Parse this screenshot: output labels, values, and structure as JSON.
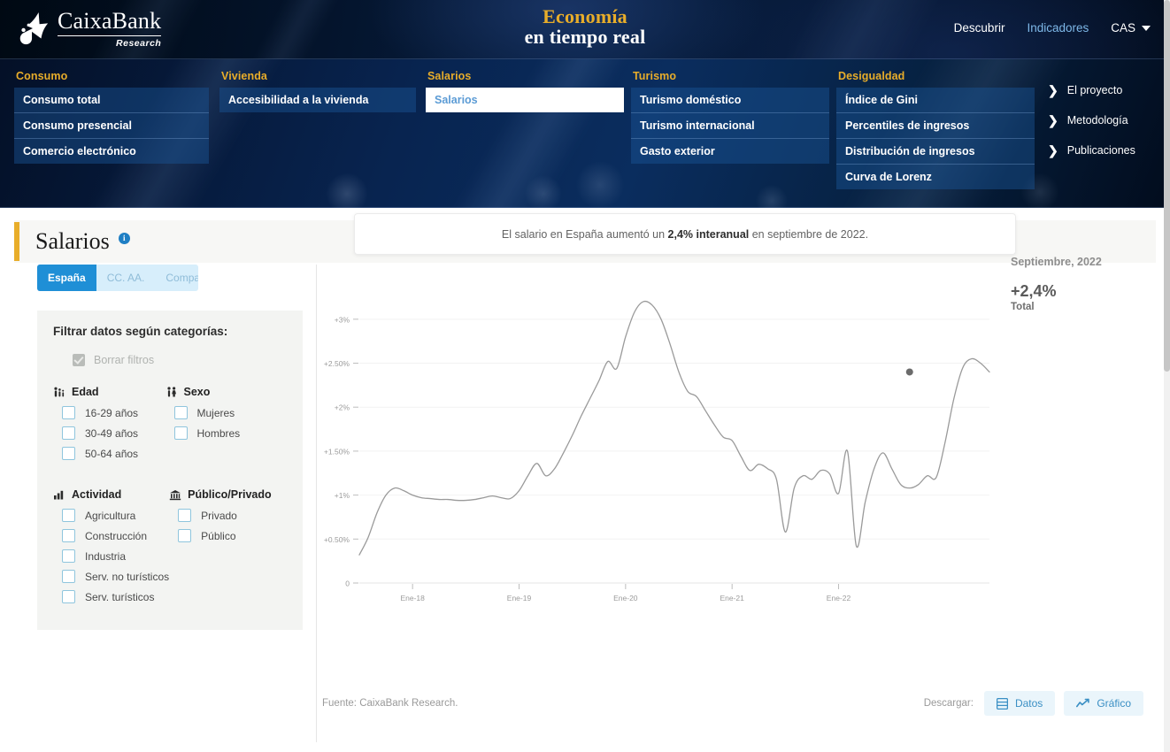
{
  "topbar": {
    "logo_name": "CaixaBank",
    "logo_sub": "Research",
    "brand_line1": "Economía",
    "brand_line2": "en tiempo real",
    "nav": [
      {
        "label": "Descubrir",
        "active": false
      },
      {
        "label": "Indicadores",
        "active": true
      }
    ],
    "lang": "CAS",
    "lang_icon": "chevron-down-icon"
  },
  "mega_menu": {
    "columns": [
      {
        "heading": "Consumo",
        "items": [
          {
            "label": "Consumo total",
            "active": false
          },
          {
            "label": "Consumo presencial",
            "active": false
          },
          {
            "label": "Comercio electrónico",
            "active": false
          }
        ]
      },
      {
        "heading": "Vivienda",
        "items": [
          {
            "label": "Accesibilidad a la vivienda",
            "active": false
          }
        ]
      },
      {
        "heading": "Salarios",
        "items": [
          {
            "label": "Salarios",
            "active": true
          }
        ]
      },
      {
        "heading": "Turismo",
        "items": [
          {
            "label": "Turismo doméstico",
            "active": false
          },
          {
            "label": "Turismo internacional",
            "active": false
          },
          {
            "label": "Gasto exterior",
            "active": false
          }
        ]
      },
      {
        "heading": "Desigualdad",
        "items": [
          {
            "label": "Índice de Gini",
            "active": false
          },
          {
            "label": "Percentiles de ingresos",
            "active": false
          },
          {
            "label": "Distribución de ingresos",
            "active": false
          },
          {
            "label": "Curva de Lorenz",
            "active": false
          }
        ]
      }
    ],
    "side_links": [
      {
        "label": "El proyecto"
      },
      {
        "label": "Metodología"
      },
      {
        "label": "Publicaciones"
      }
    ]
  },
  "page": {
    "title": "Salarios",
    "info_icon_glyph": "i",
    "tabs": [
      {
        "label": "España",
        "active": true
      },
      {
        "label": "CC. AA.",
        "active": false
      },
      {
        "label": "Comparar",
        "active": false
      }
    ]
  },
  "filters": {
    "title": "Filtrar datos según categorías:",
    "clear_label": "Borrar filtros",
    "groups": [
      {
        "label": "Edad",
        "icon": "age-people-icon",
        "options": [
          {
            "label": "16-29 años",
            "checked": false
          },
          {
            "label": "30-49 años",
            "checked": false
          },
          {
            "label": "50-64 años",
            "checked": false
          }
        ]
      },
      {
        "label": "Sexo",
        "icon": "gender-icon",
        "options": [
          {
            "label": "Mujeres",
            "checked": false
          },
          {
            "label": "Hombres",
            "checked": false
          }
        ]
      },
      {
        "label": "Actividad",
        "icon": "bar-chart-icon",
        "options": [
          {
            "label": "Agricultura",
            "checked": false
          },
          {
            "label": "Construcción",
            "checked": false
          },
          {
            "label": "Industria",
            "checked": false
          },
          {
            "label": "Serv. no turísticos",
            "checked": false
          },
          {
            "label": "Serv. turísticos",
            "checked": false
          }
        ]
      },
      {
        "label": "Público/Privado",
        "icon": "bank-building-icon",
        "options": [
          {
            "label": "Privado",
            "checked": false
          },
          {
            "label": "Público",
            "checked": false
          }
        ]
      }
    ]
  },
  "callout": {
    "prefix": "El salario en España aumentó un ",
    "highlight": "2,4% interanual",
    "suffix": " en septiembre de 2022."
  },
  "stat": {
    "date": "Septiembre, 2022",
    "value": "+2,4%",
    "label": "Total"
  },
  "footer": {
    "source": "Fuente: CaixaBank Research.",
    "download_label": "Descargar:",
    "buttons": [
      {
        "label": "Datos",
        "icon": "table-icon"
      },
      {
        "label": "Gráfico",
        "icon": "line-chart-icon"
      }
    ]
  },
  "chart_data": {
    "type": "line",
    "title": "",
    "xlabel": "",
    "ylabel": "",
    "ylim": [
      0,
      3.3
    ],
    "grid": true,
    "legend": false,
    "line_color": "#9a9a9a",
    "endpoint_color": "#6b6b6b",
    "ytick_labels": [
      "0",
      "+0.50%",
      "+1%",
      "+1.50%",
      "+2%",
      "+2.50%",
      "+3%"
    ],
    "ytick_values": [
      0,
      0.5,
      1.0,
      1.5,
      2.0,
      2.5,
      3.0
    ],
    "xtick_labels": [
      "Ene-18",
      "Ene-19",
      "Ene-20",
      "Ene-21",
      "Ene-22"
    ],
    "xtick_values": [
      "2018-01",
      "2019-01",
      "2020-01",
      "2021-01",
      "2022-01"
    ],
    "series": [
      {
        "name": "Total",
        "x": [
          "2017-07",
          "2017-08",
          "2017-09",
          "2017-10",
          "2017-11",
          "2017-12",
          "2018-01",
          "2018-02",
          "2018-03",
          "2018-04",
          "2018-05",
          "2018-06",
          "2018-07",
          "2018-08",
          "2018-09",
          "2018-10",
          "2018-11",
          "2018-12",
          "2019-01",
          "2019-02",
          "2019-03",
          "2019-04",
          "2019-05",
          "2019-06",
          "2019-07",
          "2019-08",
          "2019-09",
          "2019-10",
          "2019-11",
          "2019-12",
          "2020-01",
          "2020-02",
          "2020-03",
          "2020-04",
          "2020-05",
          "2020-06",
          "2020-07",
          "2020-08",
          "2020-09",
          "2020-10",
          "2020-11",
          "2020-12",
          "2021-01",
          "2021-02",
          "2021-03",
          "2021-04",
          "2021-05",
          "2021-06",
          "2021-07",
          "2021-08",
          "2021-09",
          "2021-10",
          "2021-11",
          "2021-12",
          "2022-01",
          "2022-02",
          "2022-03",
          "2022-04",
          "2022-05",
          "2022-06",
          "2022-07",
          "2022-08",
          "2022-09"
        ],
        "values": [
          0.32,
          0.52,
          0.8,
          1.0,
          1.08,
          1.05,
          1.0,
          0.97,
          0.96,
          0.95,
          0.95,
          0.94,
          0.94,
          0.95,
          0.97,
          0.99,
          0.97,
          0.96,
          1.05,
          1.22,
          1.36,
          1.22,
          1.3,
          1.48,
          1.68,
          1.9,
          2.1,
          2.3,
          2.52,
          2.44,
          2.8,
          3.08,
          3.2,
          3.16,
          3.0,
          2.72,
          2.4,
          2.18,
          2.12,
          1.96,
          1.8,
          1.66,
          1.62,
          1.44,
          1.28,
          1.35,
          1.3,
          1.18,
          0.58,
          1.08,
          1.22,
          1.18,
          1.28,
          1.24,
          1.02,
          1.5,
          0.42,
          0.92,
          1.3,
          1.48,
          1.3,
          1.12,
          1.08,
          1.12,
          1.22,
          1.2,
          1.6,
          2.1,
          2.45,
          2.55,
          2.5,
          2.4
        ]
      }
    ],
    "endpoint": {
      "x": "2022-09",
      "value": 2.4
    }
  }
}
